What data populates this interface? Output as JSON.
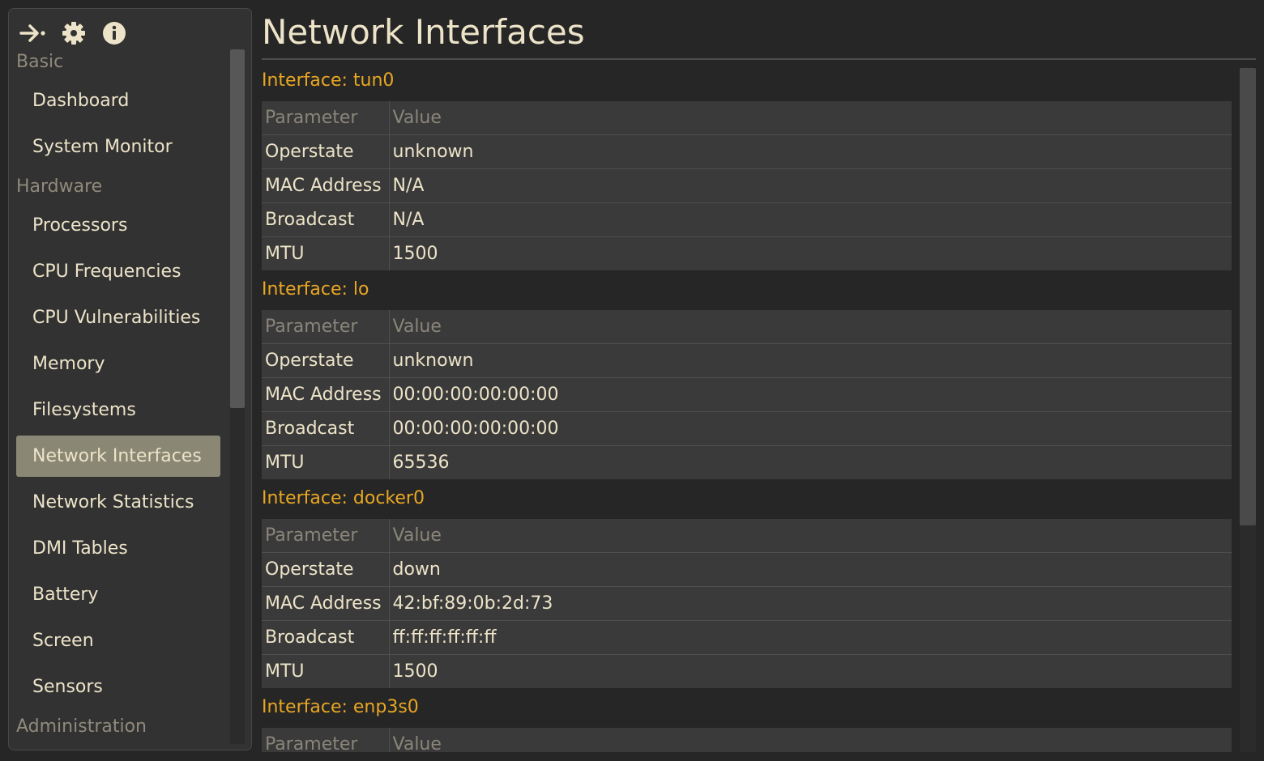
{
  "toolbar": {
    "icons": [
      "collapse-arrow-icon",
      "gear-icon",
      "info-icon"
    ]
  },
  "sidebar": {
    "sections": [
      {
        "label": "Basic",
        "items": [
          "Dashboard",
          "System Monitor"
        ]
      },
      {
        "label": "Hardware",
        "items": [
          "Processors",
          "CPU Frequencies",
          "CPU Vulnerabilities",
          "Memory",
          "Filesystems",
          "Network Interfaces",
          "Network Statistics",
          "DMI Tables",
          "Battery",
          "Screen",
          "Sensors"
        ]
      },
      {
        "label": "Administration",
        "items": []
      }
    ],
    "active_item": "Network Interfaces"
  },
  "main": {
    "title": "Network Interfaces",
    "table_headers": [
      "Parameter",
      "Value"
    ],
    "interfaces": [
      {
        "heading": "Interface: tun0",
        "rows": [
          [
            "Operstate",
            "unknown"
          ],
          [
            "MAC Address",
            "N/A"
          ],
          [
            "Broadcast",
            "N/A"
          ],
          [
            "MTU",
            "1500"
          ]
        ]
      },
      {
        "heading": "Interface: lo",
        "rows": [
          [
            "Operstate",
            "unknown"
          ],
          [
            "MAC Address",
            "00:00:00:00:00:00"
          ],
          [
            "Broadcast",
            "00:00:00:00:00:00"
          ],
          [
            "MTU",
            "65536"
          ]
        ]
      },
      {
        "heading": "Interface: docker0",
        "rows": [
          [
            "Operstate",
            "down"
          ],
          [
            "MAC Address",
            "42:bf:89:0b:2d:73"
          ],
          [
            "Broadcast",
            "ff:ff:ff:ff:ff:ff"
          ],
          [
            "MTU",
            "1500"
          ]
        ]
      },
      {
        "heading": "Interface: enp3s0",
        "rows": []
      }
    ]
  },
  "colors": {
    "background": "#262626",
    "sidebar": "#323232",
    "accent_heading": "#e8a623",
    "active_item": "#8a8774",
    "text": "#ece3c8"
  }
}
